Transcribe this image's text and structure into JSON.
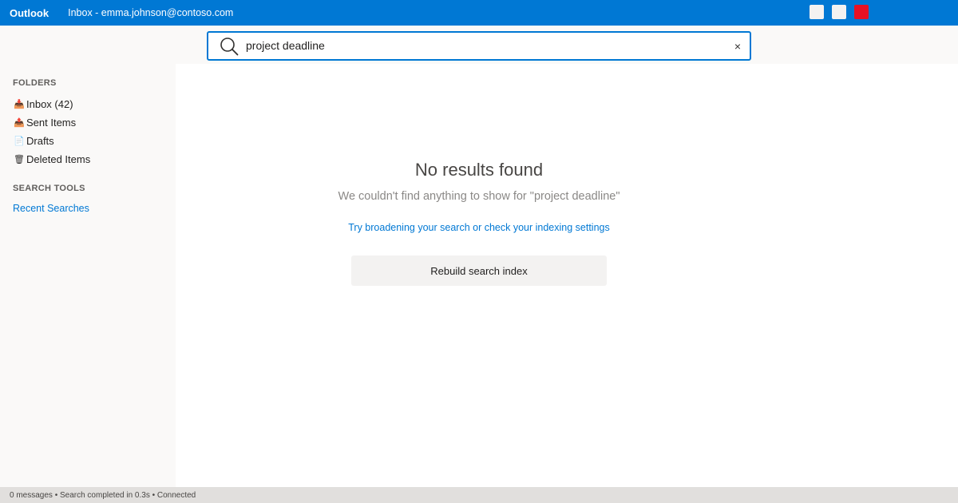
{
  "titlebar": {
    "app_name": "Outlook",
    "window_title": "Inbox - emma.johnson@contoso.com",
    "accent_color": "#0078d4",
    "close_color": "#e81123"
  },
  "search": {
    "value": "project deadline",
    "icon": "search-icon",
    "clear_icon": "close-icon",
    "clear_glyph": "×"
  },
  "sidebar": {
    "folders_heading": "FOLDERS",
    "folders": [
      {
        "icon": "inbox-icon",
        "glyph": "📥",
        "label": "Inbox (42)"
      },
      {
        "icon": "sent-icon",
        "glyph": "📤",
        "label": "Sent Items"
      },
      {
        "icon": "drafts-icon",
        "glyph": "📄",
        "label": "Drafts"
      },
      {
        "icon": "trash-icon",
        "glyph": "🗑",
        "label": "Deleted Items"
      }
    ],
    "tools_heading": "SEARCH TOOLS",
    "recent_searches": "Recent Searches"
  },
  "main": {
    "title": "No results found",
    "subtitle": "We couldn't find anything to show for \"project deadline\"",
    "help_link": "Try broadening your search or check your indexing settings",
    "rebuild_button": "Rebuild search index"
  },
  "status": {
    "text": "0 messages • Search completed in 0.3s • Connected"
  }
}
